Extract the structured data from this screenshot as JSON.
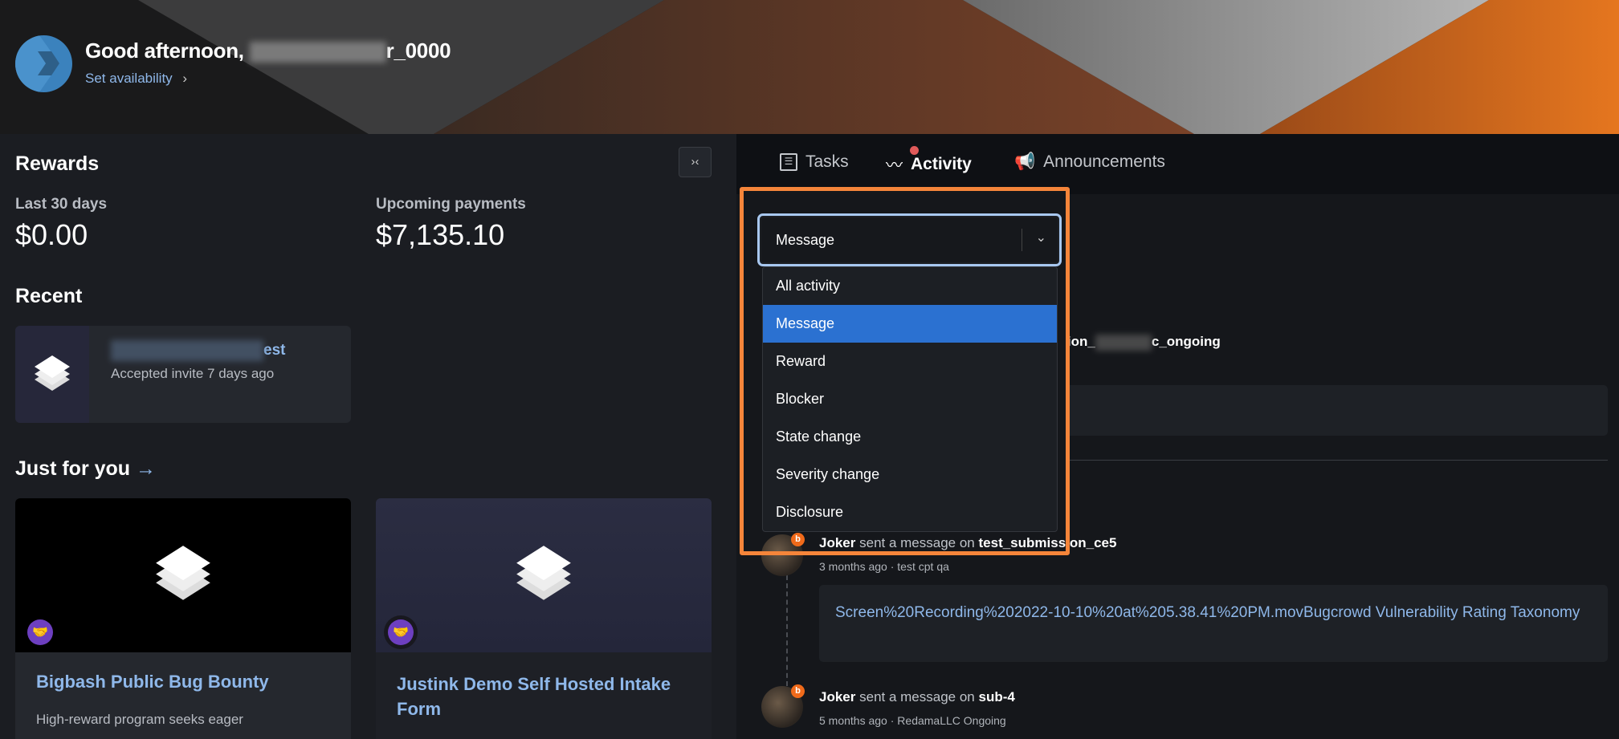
{
  "header": {
    "greeting": "Good afternoon,",
    "username_suffix": "r_0000",
    "set_availability": "Set availability"
  },
  "rewards": {
    "title": "Rewards",
    "last30_label": "Last 30 days",
    "last30_value": "$0.00",
    "upcoming_label": "Upcoming payments",
    "upcoming_value": "$7,135.10"
  },
  "recent": {
    "title": "Recent",
    "item": {
      "name_suffix": "est",
      "subtitle": "Accepted invite 7 days ago"
    }
  },
  "just_for_you": {
    "title": "Just for you",
    "cards": [
      {
        "title": "Bigbash Public Bug Bounty",
        "description": "High-reward program seeks eager"
      },
      {
        "title": "Justink Demo Self Hosted Intake Form"
      }
    ]
  },
  "tabs": [
    {
      "label": "Tasks",
      "icon": "list-icon"
    },
    {
      "label": "Activity",
      "icon": "activity-icon",
      "active": true,
      "notification": true
    },
    {
      "label": "Announcements",
      "icon": "megaphone-icon"
    }
  ],
  "filter": {
    "selected": "Message",
    "options": [
      "All activity",
      "Message",
      "Reward",
      "Blocker",
      "State change",
      "Severity change",
      "Disclosure"
    ]
  },
  "activity": [
    {
      "target_partial": "ssion_",
      "target_suffix": "c_ongoing"
    },
    {
      "user": "Joker",
      "action": "sent a message on",
      "target": "test_submission_ce5",
      "time": "3 months ago",
      "program": "test cpt qa",
      "message": "Screen%20Recording%202022-10-10%20at%205.38.41%20PM.movBugcrowd Vulnerability Rating Taxonomy"
    },
    {
      "user": "Joker",
      "action": "sent a message on",
      "target": "sub-4",
      "time": "5 months ago",
      "program": "RedamaLLC Ongoing"
    }
  ],
  "colors": {
    "accent": "#2b71d1",
    "link": "#8fb8ea",
    "highlight": "#f5853a",
    "notification": "#e05a5a"
  }
}
